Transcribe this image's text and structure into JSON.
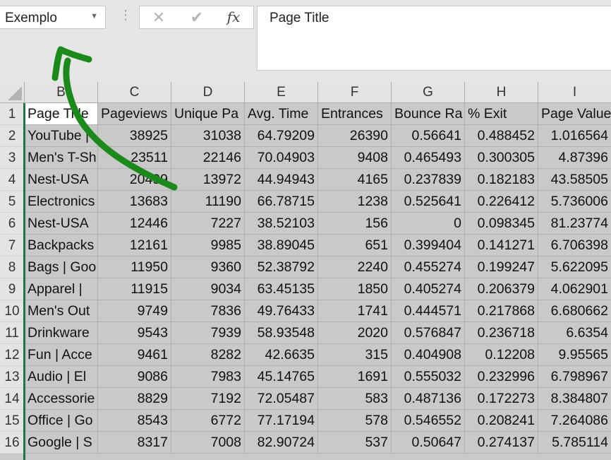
{
  "name_box": {
    "value": "Exemplo"
  },
  "formula_bar": {
    "cancel_glyph": "✕",
    "enter_glyph": "✔",
    "fx_label": "fx",
    "content": "Page Title"
  },
  "columns": [
    "B",
    "C",
    "D",
    "E",
    "F",
    "G",
    "H",
    "I"
  ],
  "rows": [
    {
      "num": "1",
      "cells": [
        "Page Title",
        "Pageviews",
        "Unique Pa",
        "Avg. Time",
        "Entrances",
        "Bounce Ra",
        "% Exit",
        "Page Value"
      ]
    },
    {
      "num": "2",
      "cells": [
        "YouTube |",
        "38925",
        "31038",
        "64.79209",
        "26390",
        "0.56641",
        "0.488452",
        "1.016564"
      ]
    },
    {
      "num": "3",
      "cells": [
        "Men's T-Sh",
        "23511",
        "22146",
        "70.04903",
        "9408",
        "0.465493",
        "0.300305",
        "4.87396"
      ]
    },
    {
      "num": "4",
      "cells": [
        "Nest-USA",
        "20499",
        "13972",
        "44.94943",
        "4165",
        "0.237839",
        "0.182183",
        "43.58505"
      ]
    },
    {
      "num": "5",
      "cells": [
        "Electronics",
        "13683",
        "11190",
        "66.78715",
        "1238",
        "0.525641",
        "0.226412",
        "5.736006"
      ]
    },
    {
      "num": "6",
      "cells": [
        "Nest-USA",
        "12446",
        "7227",
        "38.52103",
        "156",
        "0",
        "0.098345",
        "81.23774"
      ]
    },
    {
      "num": "7",
      "cells": [
        "Backpacks",
        "12161",
        "9985",
        "38.89045",
        "651",
        "0.399404",
        "0.141271",
        "6.706398"
      ]
    },
    {
      "num": "8",
      "cells": [
        "Bags | Goo",
        "11950",
        "9360",
        "52.38792",
        "2240",
        "0.455274",
        "0.199247",
        "5.622095"
      ]
    },
    {
      "num": "9",
      "cells": [
        "Apparel |",
        "11915",
        "9034",
        "63.45135",
        "1850",
        "0.405274",
        "0.206379",
        "4.062901"
      ]
    },
    {
      "num": "10",
      "cells": [
        "Men's Out",
        "9749",
        "7836",
        "49.76433",
        "1741",
        "0.444571",
        "0.217868",
        "6.680662"
      ]
    },
    {
      "num": "11",
      "cells": [
        "Drinkware",
        "9543",
        "7939",
        "58.93548",
        "2020",
        "0.576847",
        "0.236718",
        "6.6354"
      ]
    },
    {
      "num": "12",
      "cells": [
        "Fun | Acce",
        "9461",
        "8282",
        "42.6635",
        "315",
        "0.404908",
        "0.12208",
        "9.95565"
      ]
    },
    {
      "num": "13",
      "cells": [
        "Audio | El",
        "9086",
        "7983",
        "45.14765",
        "1691",
        "0.555032",
        "0.232996",
        "6.798967"
      ]
    },
    {
      "num": "14",
      "cells": [
        "Accessorie",
        "8829",
        "7192",
        "72.05487",
        "583",
        "0.487136",
        "0.172273",
        "8.384807"
      ]
    },
    {
      "num": "15",
      "cells": [
        "Office | Go",
        "8543",
        "6772",
        "77.17194",
        "578",
        "0.546552",
        "0.208241",
        "7.264086"
      ]
    },
    {
      "num": "16",
      "cells": [
        "Google | S",
        "8317",
        "7008",
        "82.90724",
        "537",
        "0.50647",
        "0.274137",
        "5.785114"
      ]
    }
  ],
  "colors": {
    "selection": "#217346",
    "annotation": "#1a8a1a"
  }
}
